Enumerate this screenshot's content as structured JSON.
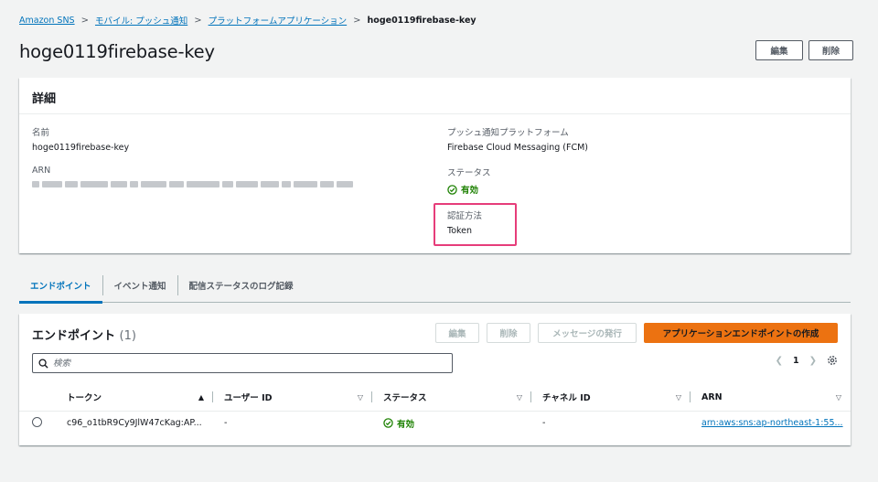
{
  "breadcrumb": {
    "items": [
      "Amazon SNS",
      "モバイル: プッシュ通知",
      "プラットフォームアプリケーション"
    ],
    "current": "hoge0119firebase-key",
    "separator": ">"
  },
  "page": {
    "title": "hoge0119firebase-key",
    "edit_label": "編集",
    "delete_label": "削除"
  },
  "details": {
    "header": "詳細",
    "name_label": "名前",
    "name_value": "hoge0119firebase-key",
    "arn_label": "ARN",
    "platform_label": "プッシュ通知プラットフォーム",
    "platform_value": "Firebase Cloud Messaging (FCM)",
    "status_label": "ステータス",
    "status_value": "有効",
    "auth_label": "認証方法",
    "auth_value": "Token"
  },
  "tabs": [
    {
      "label": "エンドポイント",
      "active": true
    },
    {
      "label": "イベント通知",
      "active": false
    },
    {
      "label": "配信ステータスのログ記録",
      "active": false
    }
  ],
  "endpoints": {
    "title": "エンドポイント",
    "count": "(1)",
    "edit_label": "編集",
    "delete_label": "削除",
    "publish_label": "メッセージの発行",
    "create_label": "アプリケーションエンドポイントの作成",
    "search_placeholder": "検索",
    "page_number": "1",
    "columns": [
      "トークン",
      "ユーザー ID",
      "ステータス",
      "チャネル ID",
      "ARN"
    ],
    "rows": [
      {
        "token": "c96_o1tbR9Cy9JlW47cKag:AP...",
        "user_id": "-",
        "status": "有効",
        "channel_id": "-",
        "arn": "arn:aws:sns:ap-northeast-1:55..."
      }
    ]
  },
  "colors": {
    "link": "#0073bb",
    "success": "#1d8102",
    "primary": "#ec7211",
    "highlight": "#e63d7a"
  }
}
